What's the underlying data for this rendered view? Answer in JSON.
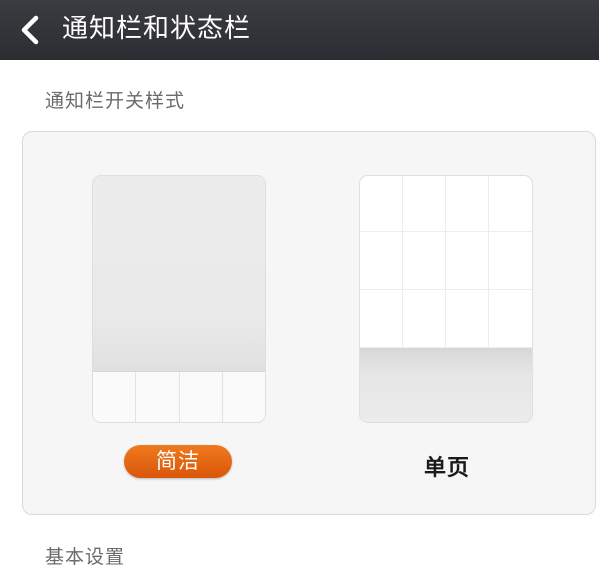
{
  "header": {
    "title": "通知栏和状态栏",
    "back_icon": "chevron-left-icon",
    "background": "#2f3136"
  },
  "sections": {
    "toggle_style_label": "通知栏开关样式",
    "basic_settings_label": "基本设置"
  },
  "toggle_styles": {
    "selected": "简洁",
    "options": [
      {
        "label": "简洁",
        "selected": true
      },
      {
        "label": "单页",
        "selected": false
      }
    ],
    "accent_color": "#e8650f"
  }
}
